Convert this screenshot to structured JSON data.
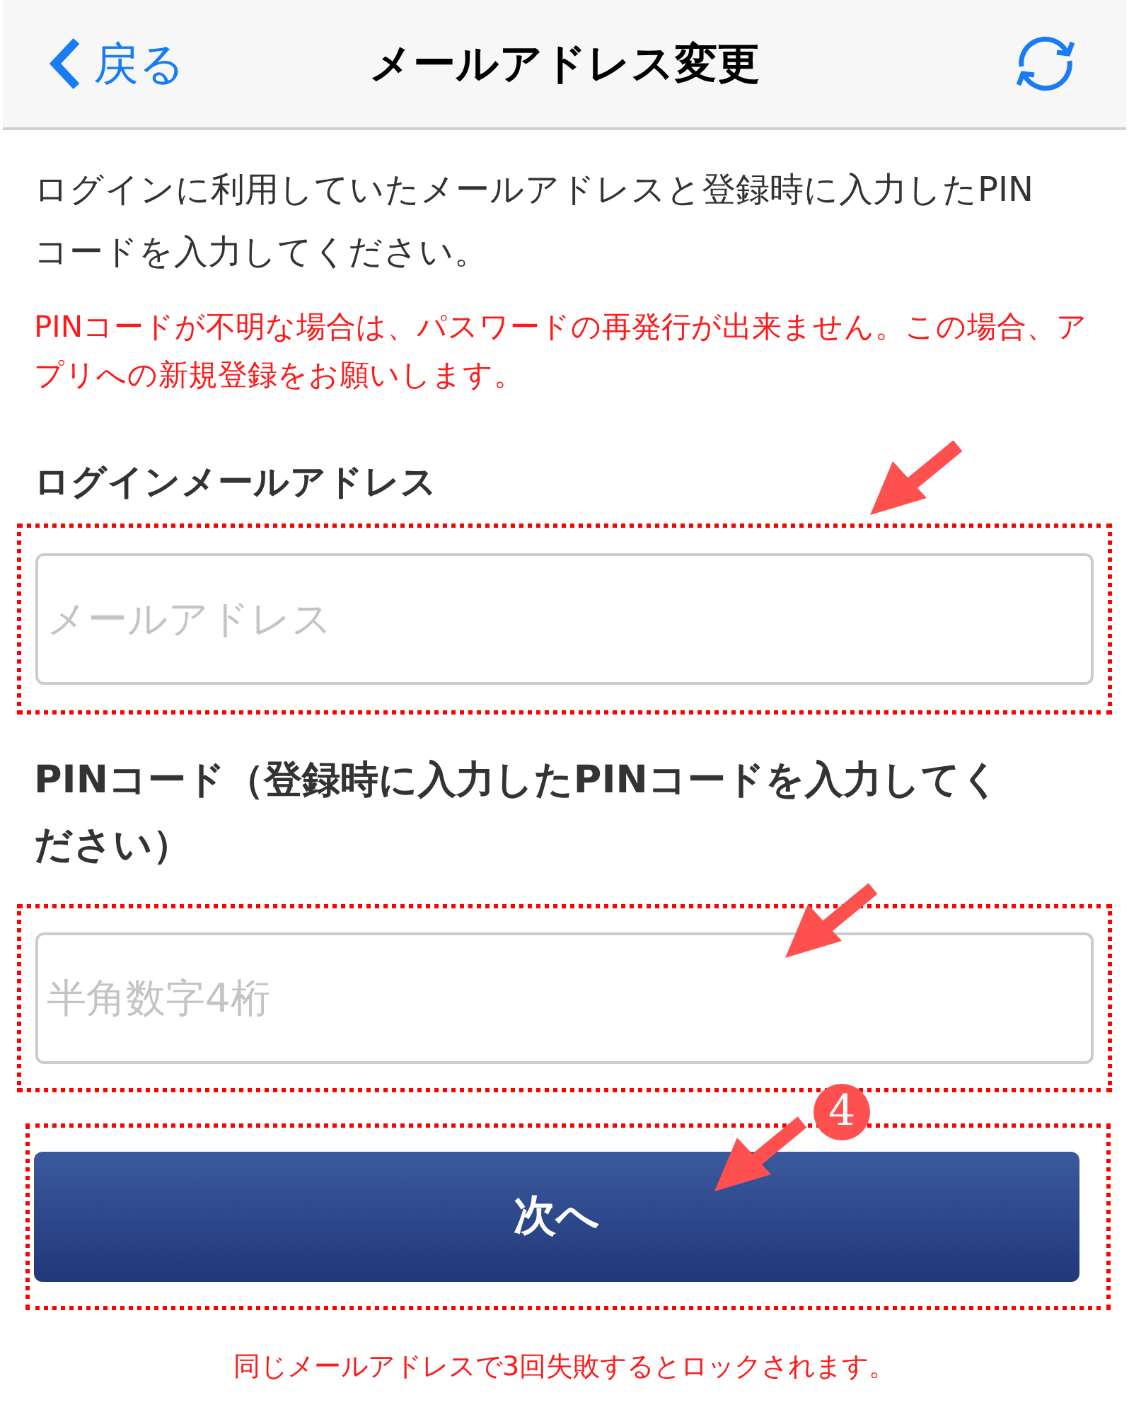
{
  "header": {
    "back": "戻る",
    "title": "メールアドレス変更"
  },
  "intro": "ログインに利用していたメールアドレスと登録時に入力したPINコードを入力してください。",
  "notice": "PINコードが不明な場合は、パスワードの再発行が出来ません。この場合、アプリへの新規登録をお願いします。",
  "fields": [
    {
      "label": "ログインメールアドレス",
      "placeholder": "メールアドレス"
    },
    {
      "label": "PINコード（登録時に入力したPINコードを入力してください）",
      "placeholder": "半角数字4桁"
    }
  ],
  "button": {
    "label": "次へ",
    "step": "4"
  },
  "footer_note": "同じメールアドレスで3回失敗するとロックされます。"
}
